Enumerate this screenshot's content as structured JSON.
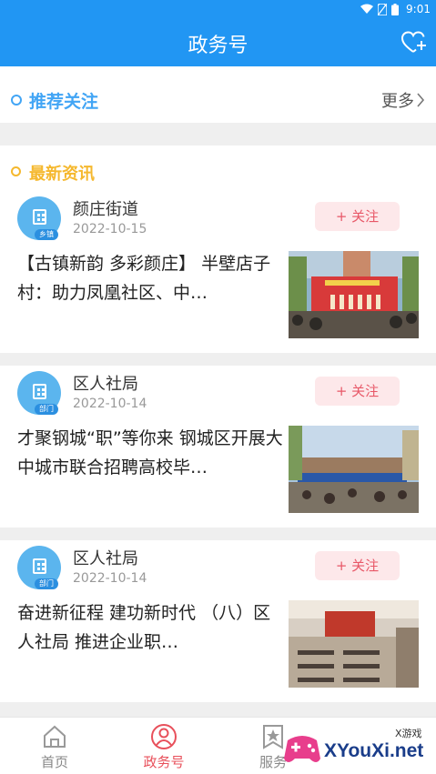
{
  "status_bar": {
    "time": "9:01"
  },
  "app_bar": {
    "title": "政务号"
  },
  "recommend": {
    "label": "推荐关注",
    "more_label": "更多"
  },
  "news": {
    "label": "最新资讯",
    "items": [
      {
        "org": "颜庄街道",
        "org_tag": "乡镇",
        "date": "2022-10-15",
        "follow_label": "+ 关注",
        "headline": "【古镇新韵 多彩颜庄】 半壁店子村：助力凤凰社区、中…"
      },
      {
        "org": "区人社局",
        "org_tag": "部门",
        "date": "2022-10-14",
        "follow_label": "+ 关注",
        "headline": "才聚钢城“职”等你来 钢城区开展大中城市联合招聘高校毕…"
      },
      {
        "org": "区人社局",
        "org_tag": "部门",
        "date": "2022-10-14",
        "follow_label": "+ 关注",
        "headline": "奋进新征程  建功新时代 （八）区人社局 推进企业职…"
      }
    ]
  },
  "tab_bar": {
    "tabs": [
      {
        "label": "首页"
      },
      {
        "label": "政务号"
      },
      {
        "label": "服务"
      }
    ]
  },
  "watermark": {
    "text": "XYouXi.net",
    "sub": "X游戏"
  },
  "colors": {
    "primary": "#2196f3",
    "accent_red": "#e8505b",
    "section_yellow": "#f5b82e",
    "section_blue": "#42a5f5"
  }
}
